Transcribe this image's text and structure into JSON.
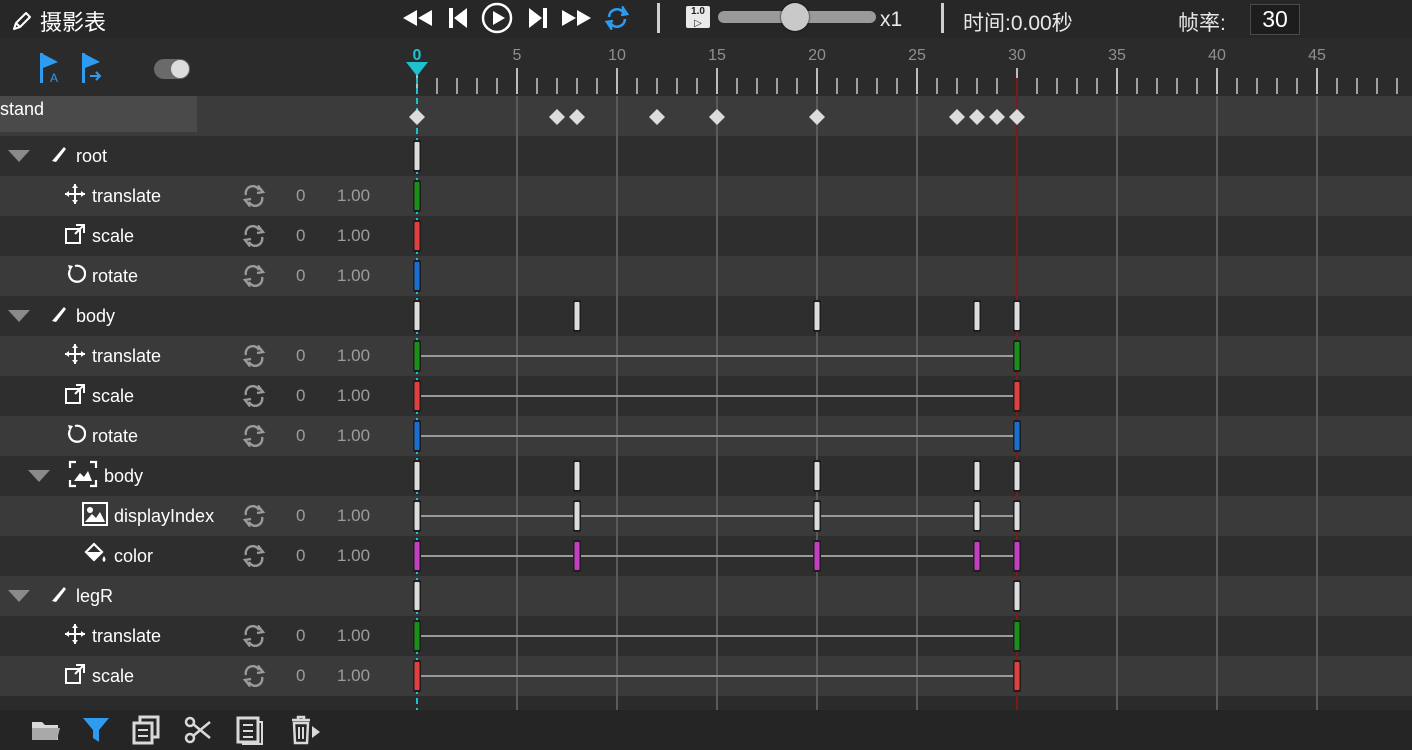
{
  "window": {
    "title": "摄影表"
  },
  "playback": {
    "speed_icon_text": "1.0",
    "speed_label": "x1",
    "speed_fraction": 0.49
  },
  "time": {
    "label": "时间:",
    "value": "0.00秒"
  },
  "fps": {
    "label": "帧率:",
    "value": "30"
  },
  "animation": {
    "name": "stand"
  },
  "ruler": {
    "ticks": [
      "0",
      "5",
      "10",
      "15",
      "20",
      "25",
      "30",
      "35",
      "40",
      "45",
      "5"
    ]
  },
  "colors": {
    "accent": "#2d9bf0",
    "cursor": "#1fc0d0",
    "green": "#1a8f1a",
    "red": "#e04040",
    "blue": "#1a6fd0",
    "magenta": "#c040c0",
    "end_line": "#7a1a1a"
  },
  "tracks": [
    {
      "label": "root",
      "kind": "bone"
    },
    {
      "label": "translate",
      "kind": "translate",
      "v0": "0",
      "v1": "1.00"
    },
    {
      "label": "scale",
      "kind": "scale",
      "v0": "0",
      "v1": "1.00"
    },
    {
      "label": "rotate",
      "kind": "rotate",
      "v0": "0",
      "v1": "1.00"
    },
    {
      "label": "body",
      "kind": "bone"
    },
    {
      "label": "translate",
      "kind": "translate",
      "v0": "0",
      "v1": "1.00"
    },
    {
      "label": "scale",
      "kind": "scale",
      "v0": "0",
      "v1": "1.00"
    },
    {
      "label": "rotate",
      "kind": "rotate",
      "v0": "0",
      "v1": "1.00"
    },
    {
      "label": "body",
      "kind": "slot"
    },
    {
      "label": "displayIndex",
      "kind": "display",
      "v0": "0",
      "v1": "1.00"
    },
    {
      "label": "color",
      "kind": "color",
      "v0": "0",
      "v1": "1.00"
    },
    {
      "label": "legR",
      "kind": "bone"
    },
    {
      "label": "translate",
      "kind": "translate",
      "v0": "0",
      "v1": "1.00"
    },
    {
      "label": "scale",
      "kind": "scale",
      "v0": "0",
      "v1": "1.00"
    }
  ]
}
